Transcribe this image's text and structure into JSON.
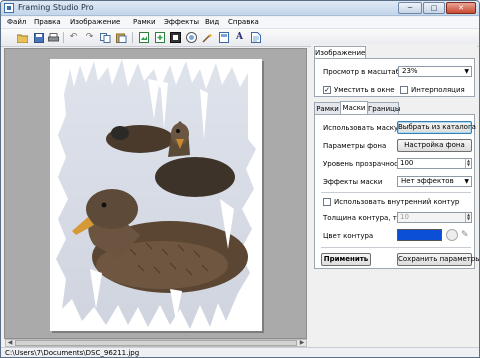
{
  "window": {
    "title": "Framing Studio Pro",
    "min": "─",
    "max": "□",
    "close": "✕"
  },
  "menu": [
    "Файл",
    "Правка",
    "Изображение",
    "Рамки",
    "Эффекты",
    "Вид",
    "Справка"
  ],
  "toolbar_icons": [
    "open-folder-icon",
    "save-icon",
    "print-icon",
    "undo-icon",
    "redo-icon",
    "copy-icon",
    "paste-icon",
    "image-icon",
    "image-add-icon",
    "frame-icon",
    "mask-icon",
    "effects-icon",
    "text-icon",
    "layout-icon"
  ],
  "status": {
    "path": "C:\\Users\\7\\Documents\\DSC_96211.jpg"
  },
  "panel": {
    "top_tab": "Изображение",
    "zoom_label": "Просмотр в масштабе",
    "zoom_value": "23%",
    "fit_label": "Уместить в окне",
    "fit_checked": true,
    "interp_label": "Интерполяция",
    "interp_checked": false,
    "tabs": [
      "Рамки",
      "Маски",
      "Границы"
    ],
    "active_tab": "Маски",
    "use_mask_label": "Использовать маску",
    "choose_catalog": "Выбрать из каталога",
    "bg_params_label": "Параметры фона",
    "bg_setup": "Настройка фона",
    "opacity_label": "Уровень прозрачности",
    "opacity_value": "100",
    "mask_effects_label": "Эффекты маски",
    "mask_effects_value": "Нет эффектов",
    "inner_contour_label": "Использовать внутренний контур",
    "inner_contour_checked": false,
    "thickness_label": "Толщина контура, точек",
    "thickness_value": "10",
    "contour_color_label": "Цвет контура",
    "contour_color": "#0a4fd6",
    "apply": "Применить",
    "save_params": "Сохранить параметры"
  }
}
